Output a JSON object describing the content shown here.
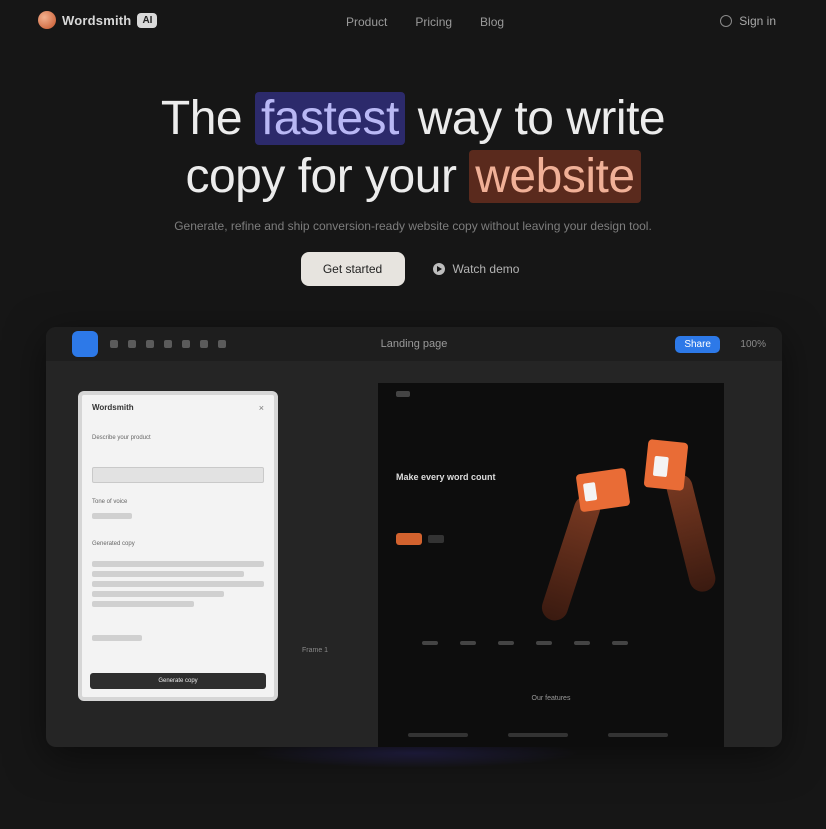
{
  "nav": {
    "brand": "Wordsmith",
    "badge": "AI",
    "links": [
      "Product",
      "Pricing",
      "Blog"
    ],
    "signin": "Sign in"
  },
  "hero": {
    "title_pre": "The",
    "title_highlight_1": "fastest",
    "title_mid": "way to write",
    "title_line2_pre": "copy for your",
    "title_highlight_2": "website",
    "subtitle": "Generate, refine and ship conversion-ready website copy without leaving your design tool.",
    "cta_primary": "Get started",
    "cta_secondary": "Watch demo"
  },
  "app": {
    "title": "Landing page",
    "share": "Share",
    "zoom": "100%",
    "panel": {
      "header": "Wordsmith",
      "close": "×",
      "field_label": "Describe your product",
      "section_label": "Tone of voice",
      "output_label": "Generated copy",
      "button": "Generate copy"
    },
    "side_label": "Frame 1",
    "preview": {
      "headline": "Make every word count",
      "section": "Our features"
    }
  },
  "colors": {
    "background": "#161616",
    "accent_blue": "#2d79e8",
    "highlight_blue": "#2c2a6b",
    "highlight_orange": "#5a2a1d",
    "brand_orange": "#e96c36"
  }
}
